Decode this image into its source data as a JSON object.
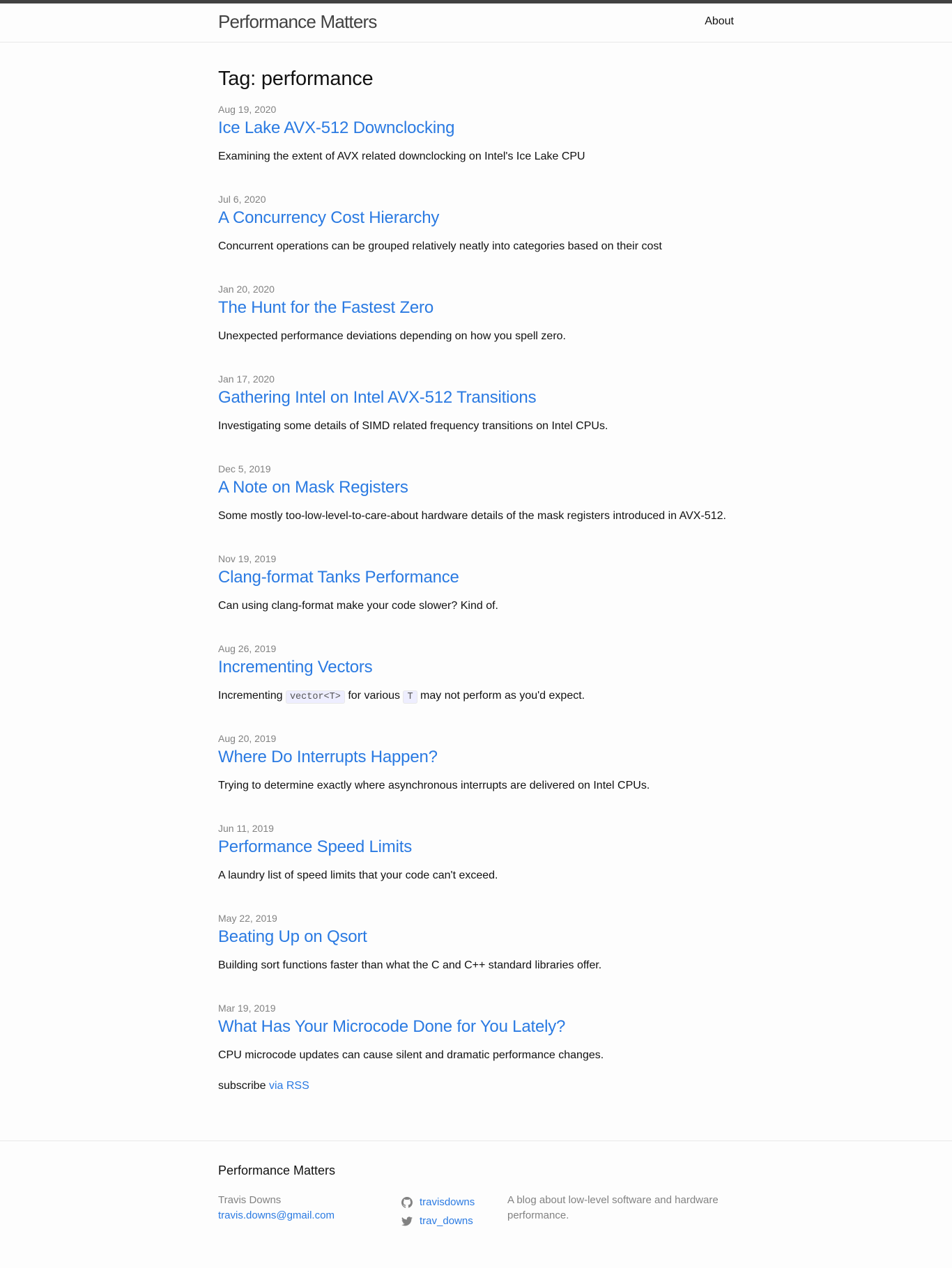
{
  "header": {
    "site_title": "Performance Matters",
    "nav": {
      "about": "About"
    }
  },
  "page": {
    "heading": "Tag: performance"
  },
  "posts": [
    {
      "date": "Aug 19, 2020",
      "title": "Ice Lake AVX-512 Downclocking",
      "excerpt": "Examining the extent of AVX related downclocking on Intel's Ice Lake CPU"
    },
    {
      "date": "Jul 6, 2020",
      "title": "A Concurrency Cost Hierarchy",
      "excerpt": "Concurrent operations can be grouped relatively neatly into categories based on their cost"
    },
    {
      "date": "Jan 20, 2020",
      "title": "The Hunt for the Fastest Zero",
      "excerpt": "Unexpected performance deviations depending on how you spell zero."
    },
    {
      "date": "Jan 17, 2020",
      "title": "Gathering Intel on Intel AVX-512 Transitions",
      "excerpt": "Investigating some details of SIMD related frequency transitions on Intel CPUs."
    },
    {
      "date": "Dec 5, 2019",
      "title": "A Note on Mask Registers",
      "excerpt": "Some mostly too-low-level-to-care-about hardware details of the mask registers introduced in AVX-512."
    },
    {
      "date": "Nov 19, 2019",
      "title": "Clang-format Tanks Performance",
      "excerpt": "Can using clang-format make your code slower? Kind of."
    },
    {
      "date": "Aug 26, 2019",
      "title": "Incrementing Vectors",
      "excerpt_parts": {
        "a": "Incrementing",
        "code1": "vector<T>",
        "b": "for various",
        "code2": "T",
        "c": "may not perform as you'd expect."
      }
    },
    {
      "date": "Aug 20, 2019",
      "title": "Where Do Interrupts Happen?",
      "excerpt": "Trying to determine exactly where asynchronous interrupts are delivered on Intel CPUs."
    },
    {
      "date": "Jun 11, 2019",
      "title": "Performance Speed Limits",
      "excerpt": "A laundry list of speed limits that your code can't exceed."
    },
    {
      "date": "May 22, 2019",
      "title": "Beating Up on Qsort",
      "excerpt": "Building sort functions faster than what the C and C++ standard libraries offer."
    },
    {
      "date": "Mar 19, 2019",
      "title": "What Has Your Microcode Done for You Lately?",
      "excerpt": "CPU microcode updates can cause silent and dramatic performance changes."
    }
  ],
  "rss": {
    "prefix": "subscribe",
    "link": "via RSS"
  },
  "footer": {
    "heading": "Performance Matters",
    "author": "Travis Downs",
    "email": "travis.downs@gmail.com",
    "github": "travisdowns",
    "twitter": "trav_downs",
    "description": "A blog about low-level software and hardware performance."
  },
  "icons": {
    "github": "github-icon",
    "twitter": "twitter-icon"
  },
  "colors": {
    "link": "#2a7ae2",
    "meta": "#828282",
    "top_bar": "#424242"
  }
}
